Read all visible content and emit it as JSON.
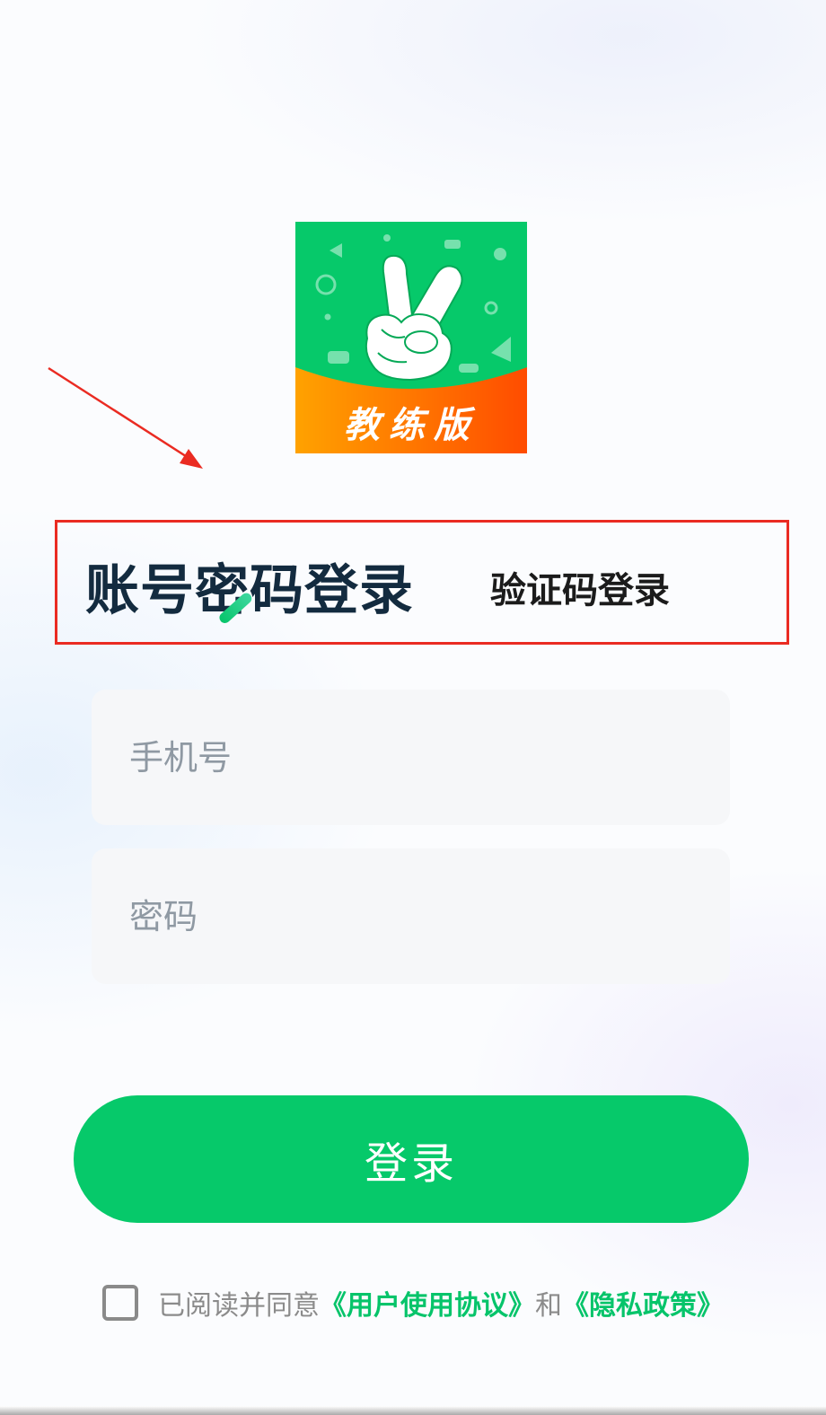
{
  "app": {
    "logo_badge_text": "教练版"
  },
  "tabs": {
    "active_label": "账号密码登录",
    "inactive_label": "验证码登录"
  },
  "form": {
    "phone_placeholder": "手机号",
    "phone_value": "",
    "password_placeholder": "密码",
    "password_value": ""
  },
  "login_button": {
    "label": "登录"
  },
  "agreement": {
    "prefix": "已阅读并同意",
    "user_agreement": "《用户使用协议》",
    "conjunction": "和",
    "privacy_policy": "《隐私政策》",
    "checked": false
  },
  "colors": {
    "brand_green": "#06c96a",
    "logo_orange": "#ff8a00",
    "annotation_red": "#ea2b22",
    "title_dark": "#132b3f"
  },
  "icons": {
    "logo": "victory-hand-icon",
    "checkbox": "checkbox-icon",
    "annotation": "annotation-arrow-icon"
  }
}
